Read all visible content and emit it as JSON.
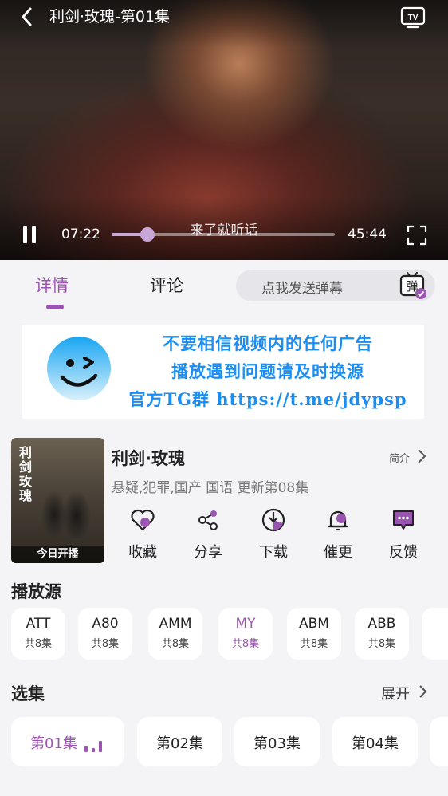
{
  "player": {
    "title": "利剑·玫瑰-第01集",
    "subtitle": "来了就听话",
    "current_time": "07:22",
    "total_time": "45:44",
    "progress": 0.16
  },
  "tabs": {
    "detail": "详情",
    "comment": "评论",
    "danmu_placeholder": "点我发送弹幕",
    "danmu_icon_char": "弹"
  },
  "banner": {
    "line1": "不要相信视频内的任何广告",
    "line2": "播放遇到问题请及时换源",
    "line3": "官方TG群 https://t.me/jdypsp"
  },
  "drama": {
    "poster_title": "利剑玫瑰",
    "poster_caption": "今日开播",
    "title": "利剑·玫瑰",
    "intro_label": "简介",
    "meta": "悬疑,犯罪,国产 国语 更新第08集"
  },
  "actions": {
    "collect": "收藏",
    "share": "分享",
    "download": "下载",
    "urge": "催更",
    "feedback": "反馈"
  },
  "sources": {
    "title": "播放源",
    "items": [
      {
        "name": "ATT",
        "count": "共8集"
      },
      {
        "name": "A80",
        "count": "共8集"
      },
      {
        "name": "AMM",
        "count": "共8集"
      },
      {
        "name": "MY",
        "count": "共8集"
      },
      {
        "name": "ABM",
        "count": "共8集"
      },
      {
        "name": "ABB",
        "count": "共8集"
      }
    ],
    "active": "MY"
  },
  "episodes": {
    "title": "选集",
    "expand_label": "展开",
    "items": [
      "第01集",
      "第02集",
      "第03集",
      "第04集"
    ],
    "active": "第01集"
  },
  "colors": {
    "accent": "#9a55b0",
    "banner_text": "#1a8ef3"
  }
}
